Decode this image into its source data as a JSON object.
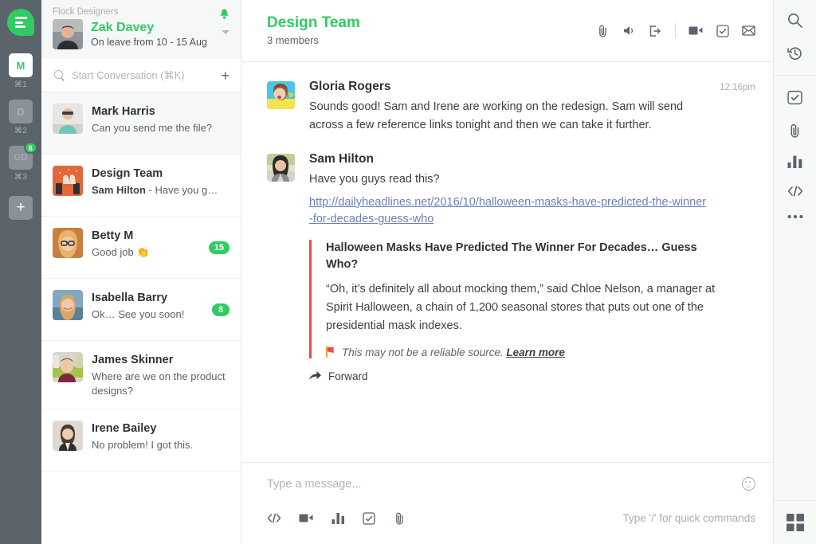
{
  "left_rail": {
    "logo_name": "flock-logo",
    "teams": [
      {
        "initials": "M",
        "shortcut": "⌘1",
        "active": true,
        "badge": null
      },
      {
        "initials": "D",
        "shortcut": "⌘2",
        "active": false,
        "badge": null
      },
      {
        "initials": "GD",
        "shortcut": "⌘3",
        "active": false,
        "badge": "8"
      }
    ],
    "add_team_label": "+"
  },
  "sidebar": {
    "org_name": "Flock Designers",
    "user": {
      "name": "Zak Davey",
      "status": "On leave from 10 - 15 Aug"
    },
    "search": {
      "placeholder": "Start Conversation (⌘K)",
      "icon": "search-icon",
      "new_label": "+"
    },
    "conversations": [
      {
        "name": "Mark Harris",
        "preview": "Can you send me the file?",
        "preview_prefix": "",
        "badge": null,
        "selected": true
      },
      {
        "name": "Design Team",
        "preview": " - Have you g…",
        "preview_prefix": "Sam Hilton",
        "badge": null,
        "selected": false
      },
      {
        "name": "Betty M",
        "preview": "Good job 👏",
        "preview_prefix": "",
        "badge": "15",
        "selected": false
      },
      {
        "name": "Isabella Barry",
        "preview": "Ok… See you soon!",
        "preview_prefix": "",
        "badge": "8",
        "selected": false
      },
      {
        "name": "James Skinner",
        "preview": "Where are we on the product designs?",
        "preview_prefix": "",
        "badge": null,
        "selected": false
      },
      {
        "name": "Irene Bailey",
        "preview": "No problem! I got this.",
        "preview_prefix": "",
        "badge": null,
        "selected": false
      }
    ]
  },
  "chat": {
    "title": "Design Team",
    "subtitle": "3 members",
    "header_actions": [
      "attachment-icon",
      "volume-icon",
      "leave-icon",
      "video-icon",
      "todo-icon",
      "mail-icon"
    ],
    "messages": [
      {
        "author": "Gloria Rogers",
        "time": "12:16pm",
        "text": "Sounds good! Sam and Irene are working on the redesign. Sam will send across a few reference links tonight and then we can take it further."
      },
      {
        "author": "Sam Hilton",
        "time": "",
        "text": "Have you guys read this?",
        "link": "http://dailyheadlines.net/2016/10/halloween-masks-have-predicted-the-winner-for-decades-guess-who",
        "attachment": {
          "title": "Halloween Masks Have Predicted The Winner For Decades… Guess Who?",
          "body": "“Oh, it’s definitely all about mocking them,” said Chloe Nelson, a manager at Spirit Halloween, a chain of 1,200 seasonal stores that puts out one of the presidential mask indexes.",
          "warning": "This may not be a reliable source.",
          "warning_link": "Learn more"
        },
        "forward_label": "Forward"
      }
    ]
  },
  "composer": {
    "placeholder": "Type a message...",
    "emoji_icon": "smiley-icon",
    "tools": [
      "code-icon",
      "video-icon",
      "poll-icon",
      "todo-icon",
      "attachment-icon"
    ],
    "hint": "Type '/' for quick commands"
  },
  "right_rail": {
    "top": [
      "search-icon",
      "history-icon"
    ],
    "middle": [
      "todo-icon",
      "attachment-icon",
      "poll-icon",
      "code-icon",
      "more-icon"
    ],
    "bottom": [
      "apps-grid-icon"
    ]
  },
  "colors": {
    "brand_green": "#2ecc62",
    "rail_gray": "#5b636b",
    "link_blue": "#6c80b8",
    "attachment_red": "#ef4b4b",
    "badge_green": "#2ecc62"
  }
}
